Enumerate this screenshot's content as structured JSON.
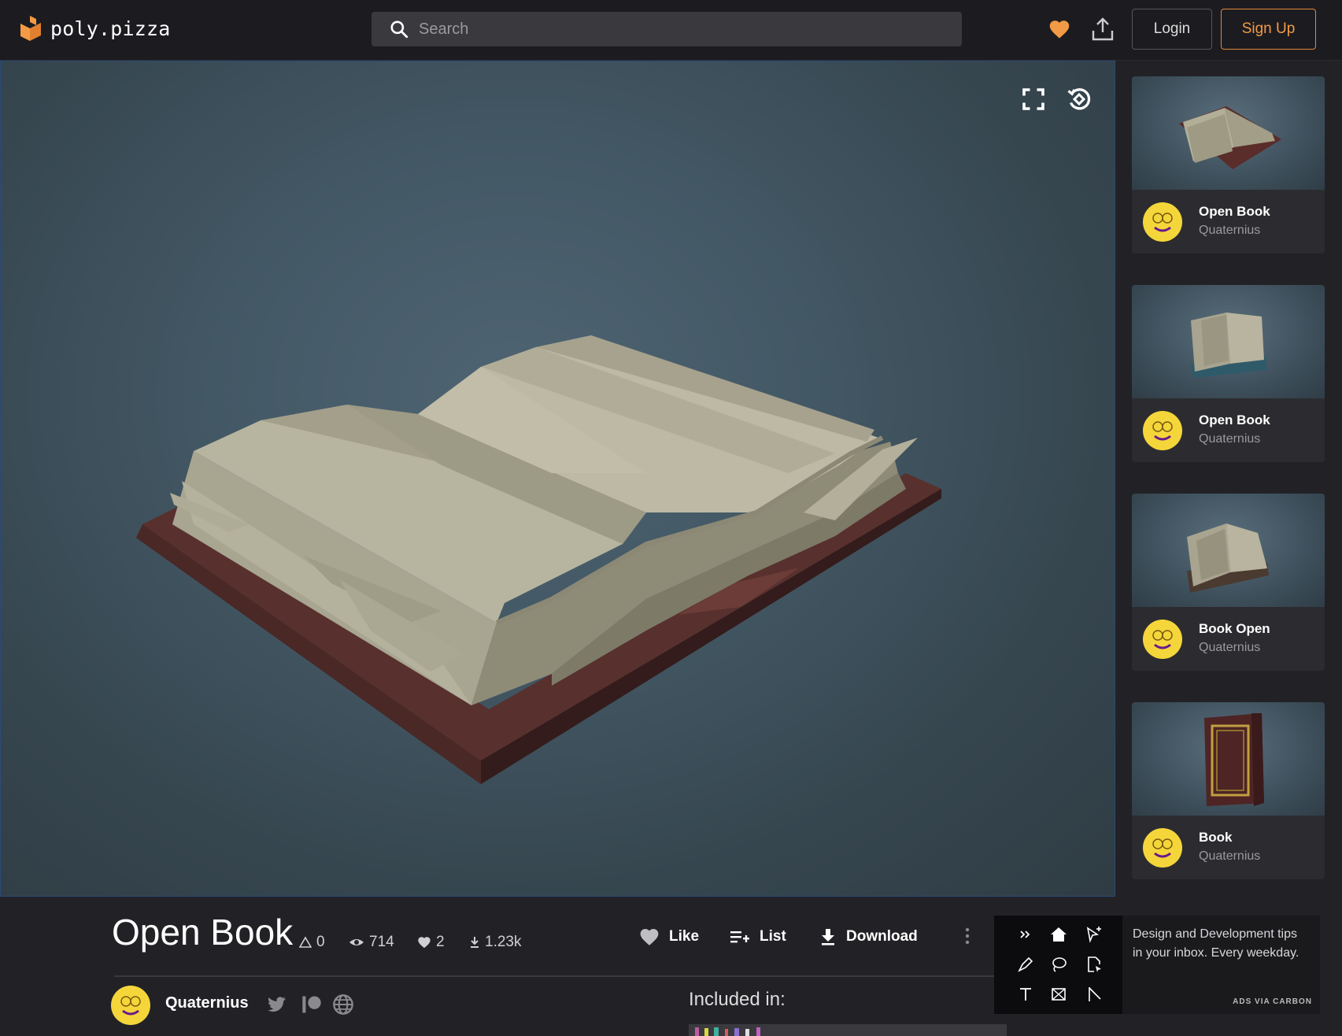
{
  "header": {
    "logo_text": "poly.pizza",
    "search_placeholder": "Search",
    "login_label": "Login",
    "signup_label": "Sign Up",
    "accent_color": "#f29a45"
  },
  "viewer": {
    "fullscreen_icon": "fullscreen-icon",
    "reset_icon": "rotate-reset-icon"
  },
  "model": {
    "title": "Open Book",
    "stats": {
      "triangles": "0",
      "views": "714",
      "likes": "2",
      "downloads": "1.23k"
    },
    "actions": {
      "like": "Like",
      "list": "List",
      "download": "Download"
    },
    "author": "Quaternius",
    "included_label": "Included in:"
  },
  "related": [
    {
      "title": "Open Book",
      "author": "Quaternius"
    },
    {
      "title": "Open Book",
      "author": "Quaternius"
    },
    {
      "title": "Book Open",
      "author": "Quaternius"
    },
    {
      "title": "Book",
      "author": "Quaternius"
    }
  ],
  "ad": {
    "text": "Design and Development tips in your inbox. Every weekday.",
    "via": "ADS VIA CARBON"
  }
}
